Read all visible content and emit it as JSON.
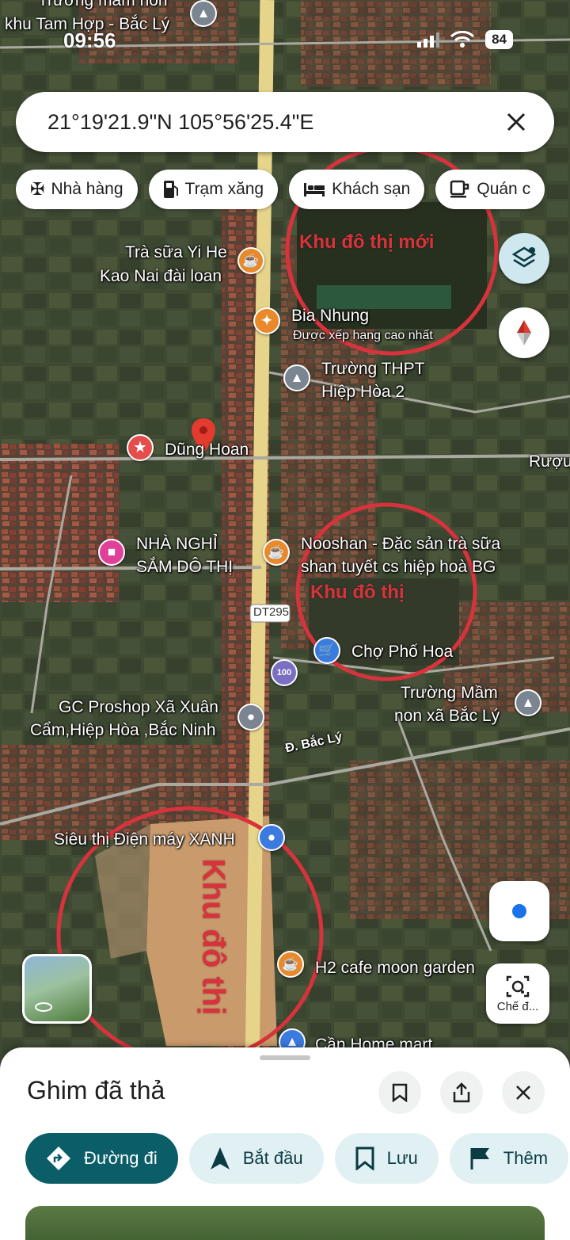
{
  "status_bar": {
    "time": "09:56",
    "battery": "84"
  },
  "search": {
    "query": "21°19'21.9\"N 105°56'25.4\"E"
  },
  "chips": [
    {
      "label": "Nhà hàng",
      "icon": "fork-knife-icon"
    },
    {
      "label": "Trạm xăng",
      "icon": "gas-station-icon"
    },
    {
      "label": "Khách sạn",
      "icon": "bed-icon"
    },
    {
      "label": "Quán c",
      "icon": "coffee-icon"
    }
  ],
  "map": {
    "road_badge": "DT295",
    "labels": {
      "top_school": "Trường mầm non",
      "top_school2": "khu Tam Hợp - Bắc Lý",
      "milk_tea": "Trà sữa Yi He",
      "milk_tea2": "Kao Nai đài loan",
      "bia": "Bia Nhung",
      "bia_sub": "Được xếp hạng cao nhất",
      "highschool": "Trường THPT",
      "highschool2": "Hiệp Hòa 2",
      "pin": "Dũng Hoan",
      "ruou": "Rượu",
      "guesthouse": "NHÀ NGHỈ",
      "guesthouse2": "SẮM DÔ THỊ",
      "nooshan": "Nooshan - Đặc sản trà sữa",
      "nooshan2": "shan tuyết cs hiệp hoà BG",
      "market": "Chợ Phố Hoa",
      "preschool": "Trường Mầm",
      "preschool2": "non xã Bắc Lý",
      "proshop": "GC Proshop Xã Xuân",
      "proshop2": "Cẩm,Hiệp Hòa ,Bắc Ninh",
      "street": "Đ. Bắc Lý",
      "dmx": "Siêu thị Điện máy XANH",
      "cafe": "H2 cafe moon garden",
      "homemart": "Cần Home mart"
    },
    "annotations": {
      "zone1": "Khu đô thị mới",
      "zone2": "Khu đô thị",
      "zone3": "Khu đô thị"
    },
    "annotation_color": "#d8323c"
  },
  "controls": {
    "lens_label": "Chế đ..."
  },
  "sheet": {
    "title": "Ghim đã thả",
    "actions": [
      {
        "label": "Đường đi",
        "icon": "directions-icon"
      },
      {
        "label": "Bắt đầu",
        "icon": "navigate-arrow-icon"
      },
      {
        "label": "Lưu",
        "icon": "bookmark-icon"
      },
      {
        "label": "Thêm",
        "icon": "flag-icon"
      }
    ]
  }
}
